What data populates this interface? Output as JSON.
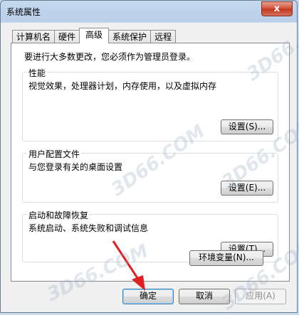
{
  "window": {
    "title": "系统属性",
    "close_glyph": "x"
  },
  "tabs": [
    {
      "label": "计算机名"
    },
    {
      "label": "硬件"
    },
    {
      "label": "高级"
    },
    {
      "label": "系统保护"
    },
    {
      "label": "远程"
    }
  ],
  "notice": "要进行大多数更改，您必须作为管理员登录。",
  "groups": {
    "performance": {
      "label": "性能",
      "desc": "视觉效果，处理器计划，内存使用，以及虚拟内存",
      "button": "设置(S)..."
    },
    "profile": {
      "label": "用户配置文件",
      "desc": "与您登录有关的桌面设置",
      "button": "设置(E)..."
    },
    "startup": {
      "label": "启动和故障恢复",
      "desc": "系统启动、系统失败和调试信息",
      "button": "设置(T)..."
    }
  },
  "env_button": "环境变量(N)...",
  "footer": {
    "ok": "确定",
    "cancel": "取消",
    "apply": "应用(A)"
  },
  "watermarks": [
    "3D66.COM",
    "3D66.COM",
    "3D66.COM",
    "3D66.COM",
    "3D66.COM"
  ],
  "colors": {
    "title_bar": "#c4d8ee",
    "close_button": "#c2351c",
    "annotation_arrow": "#e02020"
  }
}
